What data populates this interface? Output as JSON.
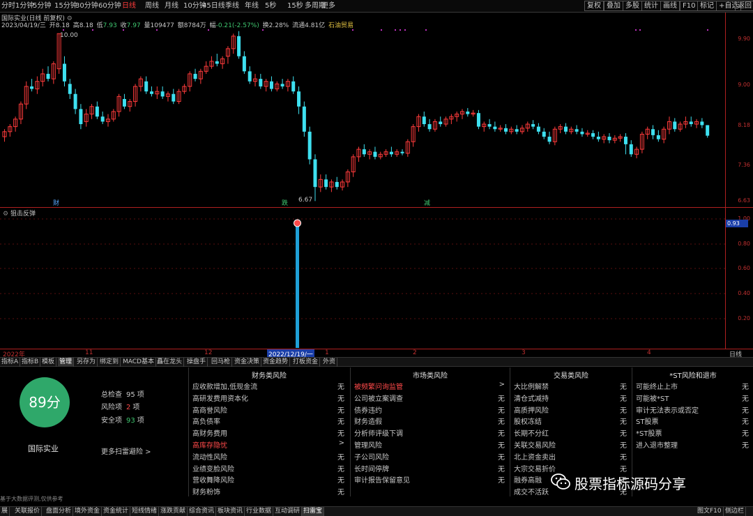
{
  "toolbar": {
    "periods": [
      "分时",
      "1分钟",
      "5分钟",
      "15分钟",
      "30分钟",
      "60分钟",
      "日线",
      "周线",
      "月线",
      "10分钟",
      "45日线",
      "季线",
      "年线",
      "5秒",
      "15秒",
      "多周期",
      "更多"
    ],
    "active_period": "日线",
    "right_buttons": [
      "复权",
      "叠加",
      "多股",
      "统计",
      "画线",
      "F10",
      "标记",
      "+自选",
      "返回"
    ]
  },
  "stock_header": {
    "name": "国际实业(日线 前复权)",
    "date": "2023/04/19/三",
    "open_label": "开",
    "open": "8.18",
    "high_label": "高",
    "high": "8.18",
    "low_label": "低",
    "low": "7.93",
    "close_label": "收",
    "close": "7.97",
    "volume_label": "量",
    "volume": "109477",
    "amount_label": "额",
    "amount": "8784万",
    "change_label": "幅",
    "change": "-0.21(-2.57%)",
    "turnover_label": "换",
    "turnover": "2.28%",
    "float_label": "流通",
    "float_cap": "4.81亿",
    "sector": "石油贸易"
  },
  "price_axis": [
    "9.90",
    "9.00",
    "8.18",
    "7.36",
    "6.63"
  ],
  "annotations": {
    "high": "10.00",
    "low": "6.67",
    "marker_cai": "财",
    "marker_die": "跌",
    "marker_jian": "减"
  },
  "indicator": {
    "title": "狙击反弹",
    "current_value": "0.93",
    "axis": [
      "1.00",
      "0.80",
      "0.60",
      "0.40",
      "0.20"
    ]
  },
  "date_axis": {
    "labels": [
      "2022年",
      "11",
      "12",
      "1",
      "2",
      "3",
      "4"
    ],
    "highlight": "2022/12/19/一",
    "period": "日线"
  },
  "tabs": [
    "指标A",
    "指标B",
    "模板",
    "管理",
    "另存为",
    "绑定到",
    "MACD基本",
    "矗在龙头",
    "操盘手",
    "回马枪",
    "资金决策",
    "资金趋势",
    "打板资金",
    "外资"
  ],
  "active_tab": "管理",
  "risk_panel": {
    "score": "89分",
    "company": "国际实业",
    "stats": [
      {
        "label": "总检查",
        "value": "95",
        "unit": "项",
        "color": "#c8c8c8"
      },
      {
        "label": "风险项",
        "value": "2",
        "unit": "项",
        "color": "#ff4a4a"
      },
      {
        "label": "安全项",
        "value": "93",
        "unit": "项",
        "color": "#3fc870"
      }
    ],
    "more": "更多扫雷避险 >",
    "disclaimer": "基于大数据评测,仅供参考",
    "columns": [
      {
        "title": "财务类风险",
        "items": [
          {
            "label": "应收款增加,低现金流",
            "value": "无",
            "warn": false
          },
          {
            "label": "高研发费用资本化",
            "value": "无",
            "warn": false
          },
          {
            "label": "高商誉风险",
            "value": "无",
            "warn": false
          },
          {
            "label": "高负债率",
            "value": "无",
            "warn": false
          },
          {
            "label": "高财务费用",
            "value": "无",
            "warn": false
          },
          {
            "label": "高库存隐忧",
            "value": ">",
            "warn": true
          },
          {
            "label": "流动性风险",
            "value": "无",
            "warn": false
          },
          {
            "label": "业绩变脸风险",
            "value": "无",
            "warn": false
          },
          {
            "label": "营收舞降风险",
            "value": "无",
            "warn": false
          },
          {
            "label": "财务粉饰",
            "value": "无",
            "warn": false
          }
        ]
      },
      {
        "title": "市场类风险",
        "items": [
          {
            "label": "被频繁问询监管",
            "value": ">",
            "warn": true
          },
          {
            "label": "公司被立案调查",
            "value": "无",
            "warn": false
          },
          {
            "label": "债券违约",
            "value": "无",
            "warn": false
          },
          {
            "label": "财务造假",
            "value": "无",
            "warn": false
          },
          {
            "label": "分析师评级下调",
            "value": "无",
            "warn": false
          },
          {
            "label": "管理风险",
            "value": "无",
            "warn": false
          },
          {
            "label": "子公司风险",
            "value": "无",
            "warn": false
          },
          {
            "label": "长时间停牌",
            "value": "无",
            "warn": false
          },
          {
            "label": "审计报告保留意见",
            "value": "无",
            "warn": false
          }
        ]
      },
      {
        "title": "交易类风险",
        "items": [
          {
            "label": "大比例解禁",
            "value": "无",
            "warn": false
          },
          {
            "label": "清仓式减持",
            "value": "无",
            "warn": false
          },
          {
            "label": "高质押风险",
            "value": "无",
            "warn": false
          },
          {
            "label": "股权冻结",
            "value": "无",
            "warn": false
          },
          {
            "label": "长期不分红",
            "value": "无",
            "warn": false
          },
          {
            "label": "关联交易风险",
            "value": "无",
            "warn": false
          },
          {
            "label": "北上资金卖出",
            "value": "无",
            "warn": false
          },
          {
            "label": "大宗交易折价",
            "value": "无",
            "warn": false
          },
          {
            "label": "融券高融",
            "value": "无",
            "warn": false
          },
          {
            "label": "成交不活跃",
            "value": "无",
            "warn": false
          }
        ]
      },
      {
        "title": "*ST风险和退市",
        "items": [
          {
            "label": "可能终止上市",
            "value": "无",
            "warn": false
          },
          {
            "label": "可能被*ST",
            "value": "无",
            "warn": false
          },
          {
            "label": "审计无法表示或否定",
            "value": "无",
            "warn": false
          },
          {
            "label": "ST股票",
            "value": "无",
            "warn": false
          },
          {
            "label": "*ST股票",
            "value": "无",
            "warn": false
          },
          {
            "label": "进入退市整理",
            "value": "无",
            "warn": false
          }
        ]
      }
    ]
  },
  "statusbar": [
    "展",
    "关联报价",
    "盘面分析",
    "境外资金",
    "资金统计",
    "短线情绪",
    "涨跌贡献",
    "综合资讯",
    "板块资讯",
    "行业数据",
    "互动调研",
    "扫雷宝"
  ],
  "statusbar_active": "扫雷宝",
  "statusbar_right": [
    "图文F10",
    "侧边栏"
  ],
  "watermark": "股票指标源码分享",
  "colors": {
    "up": "#ff3b3b",
    "down": "#3ee0f0",
    "signal": "#1fa0d8",
    "axis": "#b02020",
    "safe": "#2fa86a"
  }
}
